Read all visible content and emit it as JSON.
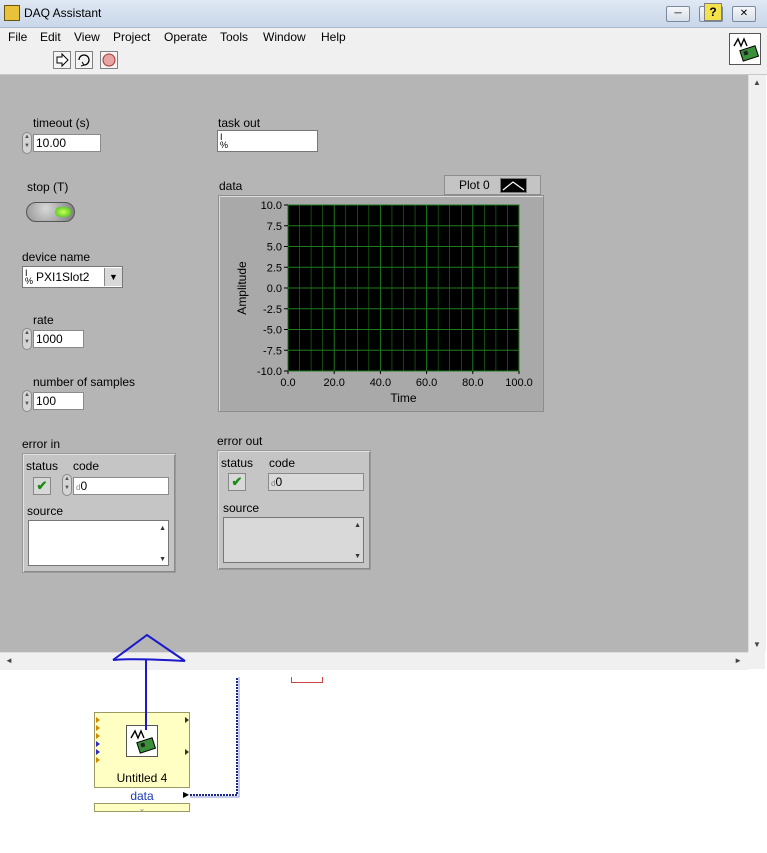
{
  "window": {
    "title": "DAQ Assistant",
    "controls": {
      "minimize": "─",
      "maximize": "□",
      "close": "✕"
    }
  },
  "menu": {
    "items": [
      "File",
      "Edit",
      "View",
      "Project",
      "Operate",
      "Tools",
      "Window",
      "Help"
    ]
  },
  "toolbar": {
    "run_icon": "run-arrow-icon",
    "run_continuous_icon": "run-continuously-icon",
    "abort_icon": "abort-icon",
    "help_label": "?"
  },
  "front_panel": {
    "timeout": {
      "label": "timeout (s)",
      "value": "10.00"
    },
    "stop": {
      "label": "stop (T)"
    },
    "device_name": {
      "label": "device name",
      "value": "PXI1Slot2",
      "io_glyph": "I/O"
    },
    "rate": {
      "label": "rate",
      "value": "1000"
    },
    "samples": {
      "label": "number of samples",
      "value": "100"
    },
    "task_out": {
      "label": "task out",
      "value": "",
      "io_glyph": "I/O"
    },
    "error_in": {
      "label": "error in",
      "status_label": "status",
      "code_label": "code",
      "code_value": "0",
      "code_prefix": "d",
      "source_label": "source",
      "source_value": ""
    },
    "error_out": {
      "label": "error out",
      "status_label": "status",
      "code_label": "code",
      "code_value": "0",
      "code_prefix": "d",
      "source_label": "source",
      "source_value": ""
    }
  },
  "chart_data": {
    "type": "line",
    "title": "data",
    "xlabel": "Time",
    "ylabel": "Amplitude",
    "xlim": [
      0,
      100
    ],
    "ylim": [
      -10,
      10
    ],
    "x_ticks": [
      "0.0",
      "20.0",
      "40.0",
      "60.0",
      "80.0",
      "100.0"
    ],
    "y_ticks": [
      "10.0",
      "7.5",
      "5.0",
      "2.5",
      "0.0",
      "-2.5",
      "-5.0",
      "-7.5",
      "-10.0"
    ],
    "grid": true,
    "legend": "top-right",
    "series": [
      {
        "name": "Plot 0",
        "values": []
      }
    ],
    "colors": {
      "plot_bg": "#000000",
      "grid": "#1d7a1d"
    }
  },
  "block_diagram": {
    "express_vi": {
      "label": "Untitled 4",
      "output": "data"
    }
  },
  "colors": {
    "panel_bg": "#b5b5b5",
    "annotation_arrow": "#1a1acc",
    "wire": "#1a2a8c",
    "express_vi_bg": "#ffffc4"
  }
}
